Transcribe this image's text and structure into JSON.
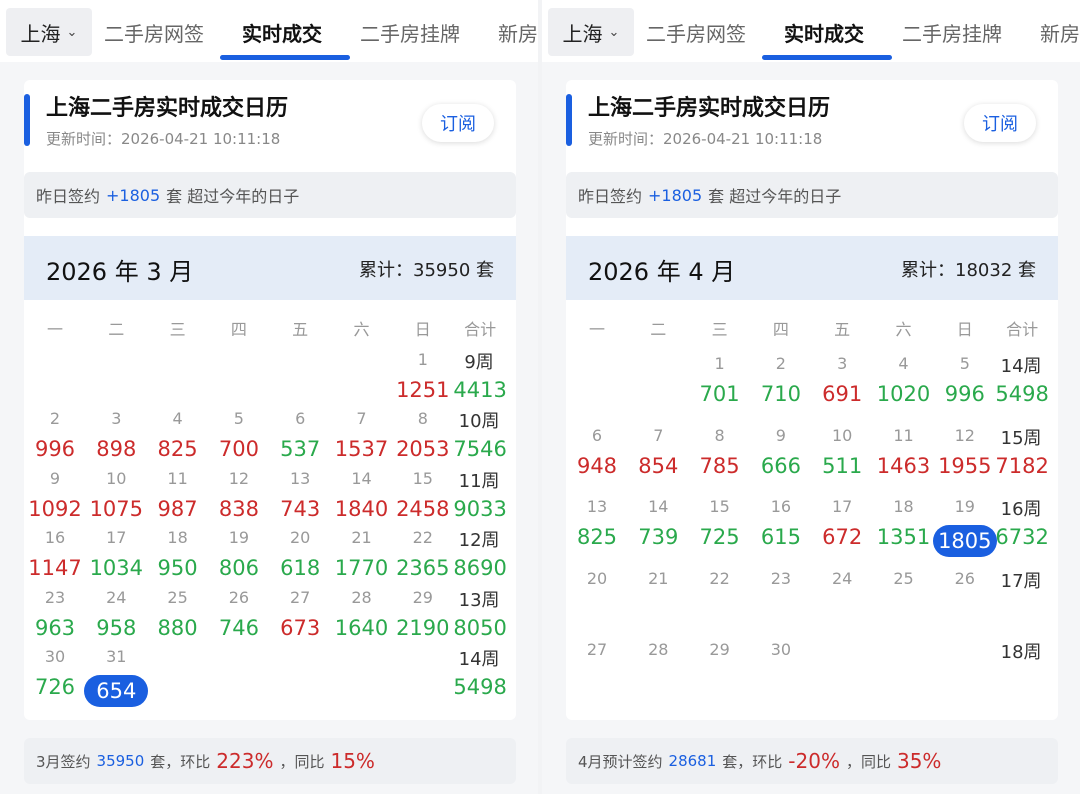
{
  "colors": {
    "accent": "#1a5fe0",
    "up": "#cc2b2b",
    "down": "#2aa94c"
  },
  "icons": {
    "city_dropdown": "chevron-down-icon"
  },
  "panels": [
    {
      "city": "上海",
      "tabs": [
        {
          "label": "二手房网签",
          "active": false
        },
        {
          "label": "实时成交",
          "active": true
        },
        {
          "label": "二手房挂牌",
          "active": false
        },
        {
          "label": "新房",
          "active": false
        }
      ],
      "title": "上海二手房实时成交日历",
      "update_time": "更新时间：2026-04-21 10:11:18",
      "subscribe_label": "订阅",
      "banner": {
        "prefix": "昨日签约",
        "value": "+1805",
        "suffix": "套 超过今年的日子"
      },
      "month_title": "2026 年 3 月",
      "month_total": "累计：35950 套",
      "weekday_headers": [
        "一",
        "二",
        "三",
        "四",
        "五",
        "六",
        "日",
        "合计"
      ],
      "weeks": [
        {
          "days": [
            "",
            "",
            "",
            "",
            "",
            "",
            "1"
          ],
          "label": "9周",
          "values": [
            null,
            null,
            null,
            null,
            null,
            null,
            {
              "v": "1251",
              "c": "r"
            }
          ],
          "sum": "4413"
        },
        {
          "days": [
            "2",
            "3",
            "4",
            "5",
            "6",
            "7",
            "8"
          ],
          "label": "10周",
          "values": [
            {
              "v": "996",
              "c": "r"
            },
            {
              "v": "898",
              "c": "r"
            },
            {
              "v": "825",
              "c": "r"
            },
            {
              "v": "700",
              "c": "r"
            },
            {
              "v": "537",
              "c": "g"
            },
            {
              "v": "1537",
              "c": "r"
            },
            {
              "v": "2053",
              "c": "r"
            }
          ],
          "sum": "7546"
        },
        {
          "days": [
            "9",
            "10",
            "11",
            "12",
            "13",
            "14",
            "15"
          ],
          "label": "11周",
          "values": [
            {
              "v": "1092",
              "c": "r"
            },
            {
              "v": "1075",
              "c": "r"
            },
            {
              "v": "987",
              "c": "r"
            },
            {
              "v": "838",
              "c": "r"
            },
            {
              "v": "743",
              "c": "r"
            },
            {
              "v": "1840",
              "c": "r"
            },
            {
              "v": "2458",
              "c": "r"
            }
          ],
          "sum": "9033"
        },
        {
          "days": [
            "16",
            "17",
            "18",
            "19",
            "20",
            "21",
            "22"
          ],
          "label": "12周",
          "values": [
            {
              "v": "1147",
              "c": "r"
            },
            {
              "v": "1034",
              "c": "g"
            },
            {
              "v": "950",
              "c": "g"
            },
            {
              "v": "806",
              "c": "g"
            },
            {
              "v": "618",
              "c": "g"
            },
            {
              "v": "1770",
              "c": "g"
            },
            {
              "v": "2365",
              "c": "g"
            }
          ],
          "sum": "8690"
        },
        {
          "days": [
            "23",
            "24",
            "25",
            "26",
            "27",
            "28",
            "29"
          ],
          "label": "13周",
          "values": [
            {
              "v": "963",
              "c": "g"
            },
            {
              "v": "958",
              "c": "g"
            },
            {
              "v": "880",
              "c": "g"
            },
            {
              "v": "746",
              "c": "g"
            },
            {
              "v": "673",
              "c": "r"
            },
            {
              "v": "1640",
              "c": "g"
            },
            {
              "v": "2190",
              "c": "g"
            }
          ],
          "sum": "8050"
        },
        {
          "days": [
            "30",
            "31",
            "",
            "",
            "",
            "",
            ""
          ],
          "label": "14周",
          "values": [
            {
              "v": "726",
              "c": "g"
            },
            {
              "v": "654",
              "c": "h"
            },
            null,
            null,
            null,
            null,
            null
          ],
          "sum": "5498"
        }
      ],
      "footer": {
        "prefix": "3月签约",
        "value": "35950",
        "mid": "套，环比",
        "mom": "223%",
        "sep": "，同比",
        "yoy": "15%"
      }
    },
    {
      "city": "上海",
      "tabs": [
        {
          "label": "二手房网签",
          "active": false
        },
        {
          "label": "实时成交",
          "active": true
        },
        {
          "label": "二手房挂牌",
          "active": false
        },
        {
          "label": "新房",
          "active": false
        }
      ],
      "title": "上海二手房实时成交日历",
      "update_time": "更新时间：2026-04-21 10:11:18",
      "subscribe_label": "订阅",
      "banner": {
        "prefix": "昨日签约",
        "value": "+1805",
        "suffix": "套 超过今年的日子"
      },
      "month_title": "2026 年 4 月",
      "month_total": "累计：18032 套",
      "weekday_headers": [
        "一",
        "二",
        "三",
        "四",
        "五",
        "六",
        "日",
        "合计"
      ],
      "weeks": [
        {
          "days": [
            "",
            "",
            "1",
            "2",
            "3",
            "4",
            "5"
          ],
          "label": "14周",
          "values": [
            null,
            null,
            {
              "v": "701",
              "c": "g"
            },
            {
              "v": "710",
              "c": "g"
            },
            {
              "v": "691",
              "c": "r"
            },
            {
              "v": "1020",
              "c": "g"
            },
            {
              "v": "996",
              "c": "g"
            }
          ],
          "sum": "5498"
        },
        {
          "days": [
            "6",
            "7",
            "8",
            "9",
            "10",
            "11",
            "12"
          ],
          "label": "15周",
          "values": [
            {
              "v": "948",
              "c": "r"
            },
            {
              "v": "854",
              "c": "r"
            },
            {
              "v": "785",
              "c": "r"
            },
            {
              "v": "666",
              "c": "g"
            },
            {
              "v": "511",
              "c": "g"
            },
            {
              "v": "1463",
              "c": "r"
            },
            {
              "v": "1955",
              "c": "r"
            }
          ],
          "sum": "7182",
          "sum_color": "r"
        },
        {
          "days": [
            "13",
            "14",
            "15",
            "16",
            "17",
            "18",
            "19"
          ],
          "label": "16周",
          "values": [
            {
              "v": "825",
              "c": "g"
            },
            {
              "v": "739",
              "c": "g"
            },
            {
              "v": "725",
              "c": "g"
            },
            {
              "v": "615",
              "c": "g"
            },
            {
              "v": "672",
              "c": "r"
            },
            {
              "v": "1351",
              "c": "g"
            },
            {
              "v": "1805",
              "c": "h"
            }
          ],
          "sum": "6732"
        },
        {
          "days": [
            "20",
            "21",
            "22",
            "23",
            "24",
            "25",
            "26"
          ],
          "label": "17周",
          "values": [
            null,
            null,
            null,
            null,
            null,
            null,
            null
          ],
          "sum": ""
        },
        {
          "days": [
            "27",
            "28",
            "29",
            "30",
            "",
            "",
            ""
          ],
          "label": "18周",
          "values": [
            null,
            null,
            null,
            null,
            null,
            null,
            null
          ],
          "sum": ""
        }
      ],
      "footer": {
        "prefix": "4月预计签约",
        "value": "28681",
        "mid": "套，环比",
        "mom": "-20%",
        "sep": "，同比",
        "yoy": "35%"
      }
    }
  ]
}
